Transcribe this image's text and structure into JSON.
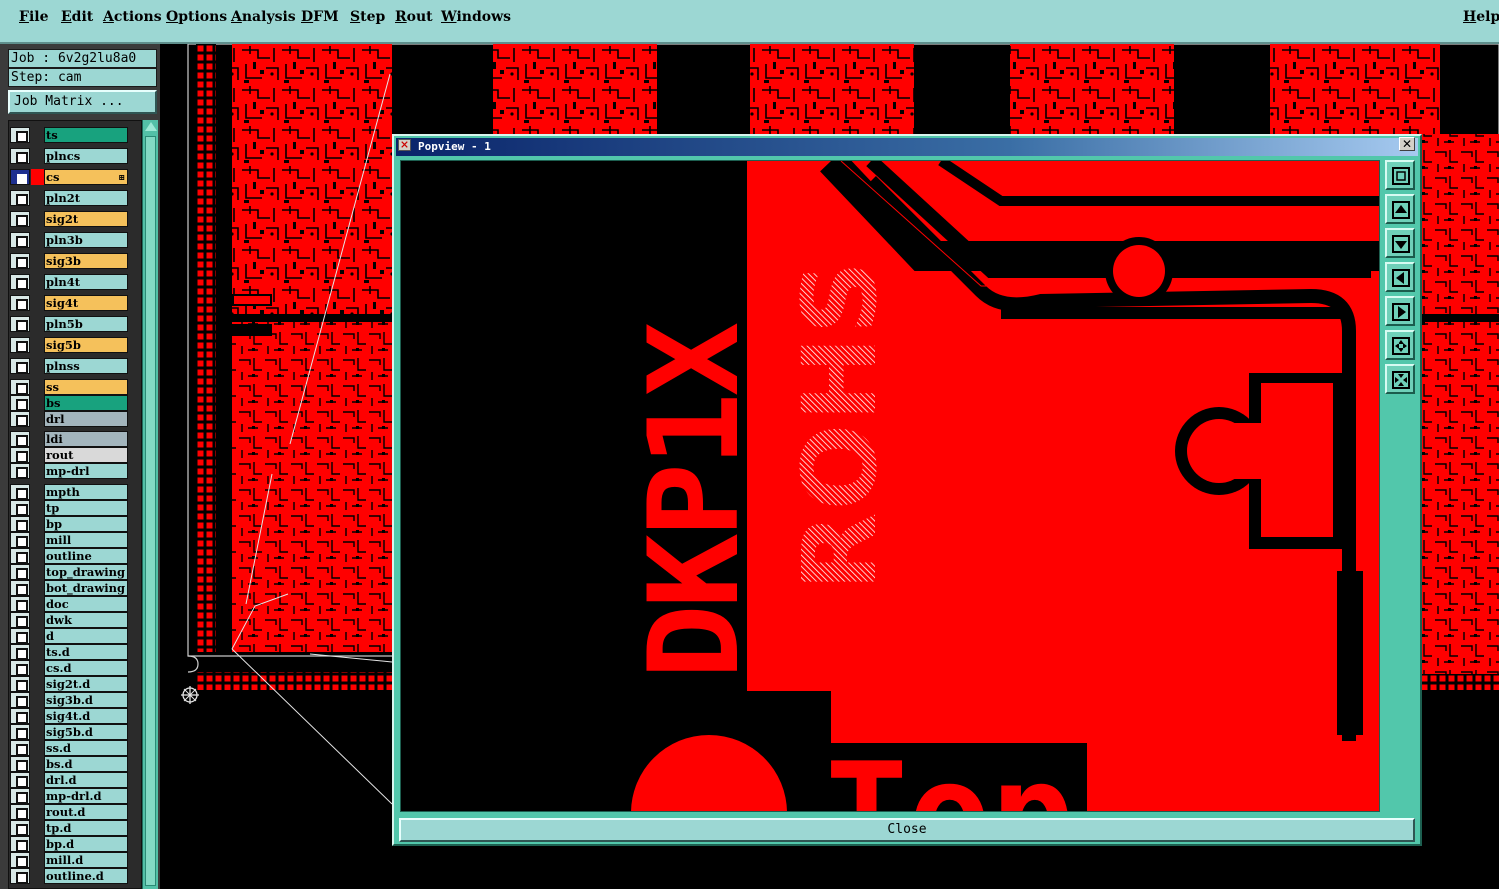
{
  "menubar": {
    "items": [
      "File",
      "Edit",
      "Actions",
      "Options",
      "Analysis",
      "DFM",
      "Step",
      "Rout",
      "Windows"
    ],
    "help": "Help"
  },
  "job": {
    "job_label": "Job : 6v2g2lu8a0",
    "step_label": "Step: cam",
    "matrix_button": "Job Matrix ..."
  },
  "layers": [
    {
      "name": "ts",
      "color": "green"
    },
    {
      "name": "plncs",
      "color": "cyan"
    },
    {
      "name": "cs",
      "color": "yellow",
      "active": true
    },
    {
      "name": "pln2t",
      "color": "cyan"
    },
    {
      "name": "sig2t",
      "color": "yellow"
    },
    {
      "name": "pln3b",
      "color": "cyan"
    },
    {
      "name": "sig3b",
      "color": "yellow"
    },
    {
      "name": "pln4t",
      "color": "cyan"
    },
    {
      "name": "sig4t",
      "color": "yellow"
    },
    {
      "name": "pln5b",
      "color": "cyan"
    },
    {
      "name": "sig5b",
      "color": "yellow"
    },
    {
      "name": "plnss",
      "color": "cyan"
    },
    {
      "name": "ss",
      "color": "yellow"
    },
    {
      "name": "bs",
      "color": "green"
    },
    {
      "name": "drl",
      "color": "grey"
    },
    {
      "name": "ldi",
      "color": "grey"
    },
    {
      "name": "rout",
      "color": "lightgrey"
    },
    {
      "name": "mp-drl",
      "color": "cyan"
    },
    {
      "name": "mpth",
      "color": "cyan"
    },
    {
      "name": "tp",
      "color": "cyan"
    },
    {
      "name": "bp",
      "color": "cyan"
    },
    {
      "name": "mill",
      "color": "cyan"
    },
    {
      "name": "outline",
      "color": "cyan"
    },
    {
      "name": "top_drawing",
      "color": "cyan"
    },
    {
      "name": "bot_drawing",
      "color": "cyan"
    },
    {
      "name": "doc",
      "color": "cyan"
    },
    {
      "name": "dwk",
      "color": "cyan"
    },
    {
      "name": "d",
      "color": "cyan"
    },
    {
      "name": "ts.d",
      "color": "cyan"
    },
    {
      "name": "cs.d",
      "color": "cyan"
    },
    {
      "name": "sig2t.d",
      "color": "cyan"
    },
    {
      "name": "sig3b.d",
      "color": "cyan"
    },
    {
      "name": "sig4t.d",
      "color": "cyan"
    },
    {
      "name": "sig5b.d",
      "color": "cyan"
    },
    {
      "name": "ss.d",
      "color": "cyan"
    },
    {
      "name": "bs.d",
      "color": "cyan"
    },
    {
      "name": "drl.d",
      "color": "cyan"
    },
    {
      "name": "mp-drl.d",
      "color": "cyan"
    },
    {
      "name": "rout.d",
      "color": "cyan"
    },
    {
      "name": "tp.d",
      "color": "cyan"
    },
    {
      "name": "bp.d",
      "color": "cyan"
    },
    {
      "name": "mill.d",
      "color": "cyan"
    },
    {
      "name": "outline.d",
      "color": "cyan"
    }
  ],
  "popview": {
    "title": "Popview - 1",
    "close_button": "Close",
    "silkscreen": {
      "part_text": "DKP1X",
      "rohs_text": "ROHS",
      "top_text": "Top"
    },
    "tools": [
      "zoom-fit-icon",
      "pan-up-icon",
      "pan-down-icon",
      "pan-left-icon",
      "pan-right-icon",
      "zoom-in-icon",
      "zoom-out-icon"
    ]
  },
  "colors": {
    "copper": "#ff0000",
    "background": "#000000",
    "panel": "#9cd7d3",
    "window": "#52c7ab"
  }
}
